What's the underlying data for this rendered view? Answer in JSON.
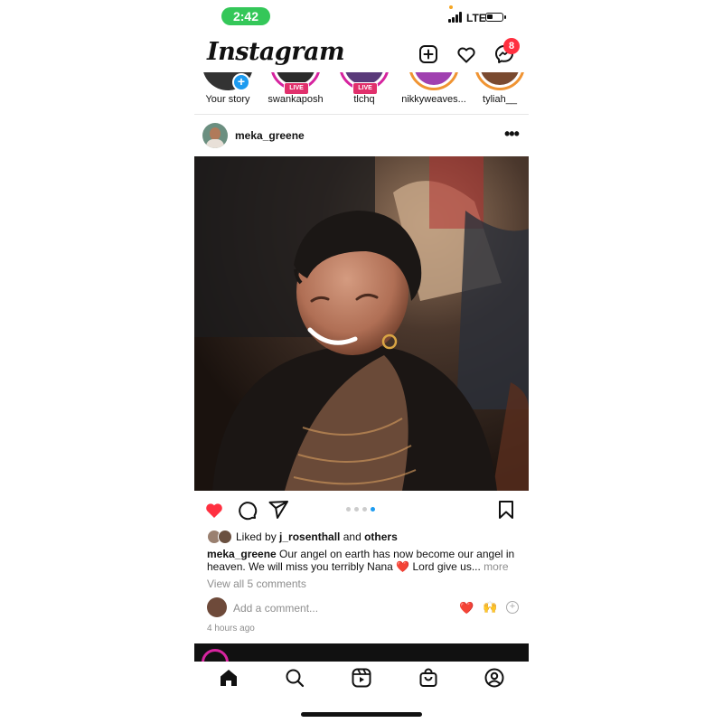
{
  "status": {
    "time": "2:42",
    "network": "LTE"
  },
  "header": {
    "logo": "Instagram",
    "messenger_badge": "8"
  },
  "stories": [
    {
      "label": "Your story",
      "kind": "own"
    },
    {
      "label": "swankaposh",
      "kind": "live",
      "badge": "LIVE"
    },
    {
      "label": "tlchq",
      "kind": "live",
      "badge": "LIVE"
    },
    {
      "label": "nikkyweaves...",
      "kind": "ring"
    },
    {
      "label": "tyliah__",
      "kind": "ring"
    }
  ],
  "post": {
    "username": "meka_greene",
    "carousel": {
      "count": 4,
      "active": 3
    },
    "liked_by_prefix": "Liked by ",
    "liked_by_user": "j_rosenthall",
    "liked_by_and": " and ",
    "liked_by_others": "others",
    "caption_user": "meka_greene",
    "caption_text": " Our angel on earth has now become our angel in heaven. We will miss you terribly Nana ❤️ Lord give us...",
    "caption_more": " more",
    "view_comments": "View all 5 comments",
    "add_comment_placeholder": "Add a comment...",
    "quick_reactions": [
      "❤️",
      "🙌"
    ],
    "time_ago": "4 hours ago"
  },
  "colors": {
    "like_red": "#ff3040",
    "live_pink": "#e1306c",
    "accent_blue": "#1d9bf0",
    "status_green": "#34c759"
  },
  "icons": {
    "header": [
      "new-post-icon",
      "heart-icon",
      "messenger-icon"
    ],
    "actions": [
      "like-heart-icon",
      "comment-icon",
      "share-icon",
      "save-bookmark-icon"
    ],
    "tabs": [
      "home-icon",
      "search-icon",
      "reels-icon",
      "shop-icon",
      "profile-icon"
    ]
  }
}
